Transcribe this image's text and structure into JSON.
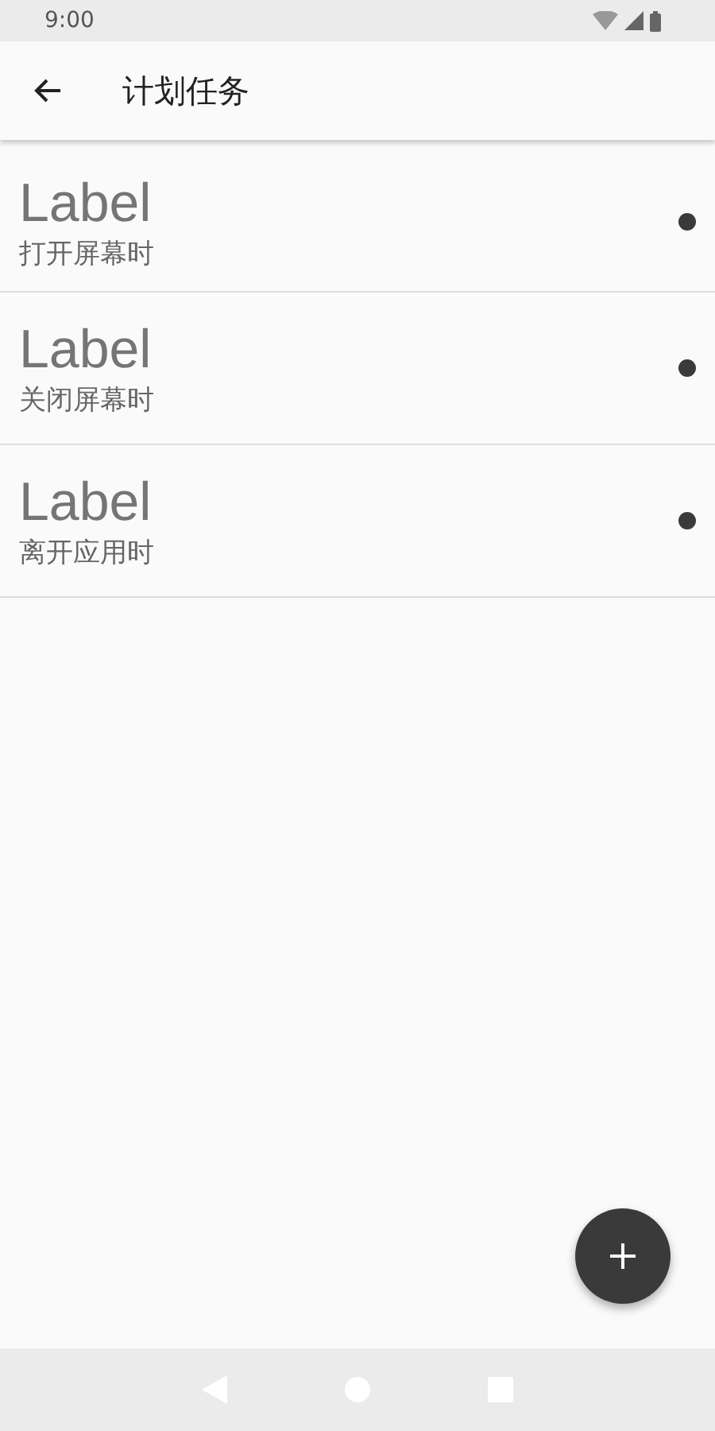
{
  "status_bar": {
    "time": "9:00"
  },
  "app_bar": {
    "title": "计划任务"
  },
  "tasks": [
    {
      "label": "Label",
      "trigger": "打开屏幕时"
    },
    {
      "label": "Label",
      "trigger": "关闭屏幕时"
    },
    {
      "label": "Label",
      "trigger": "离开应用时"
    }
  ]
}
